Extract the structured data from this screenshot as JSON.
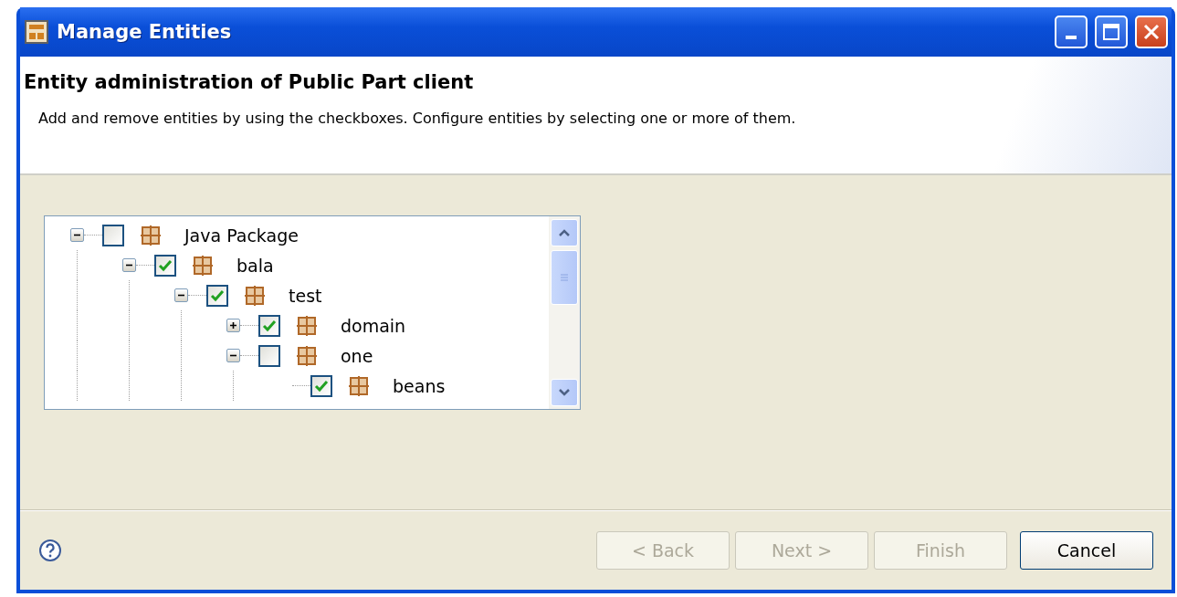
{
  "window": {
    "title": "Manage Entities"
  },
  "header": {
    "title": "Entity administration of Public Part client",
    "description": "Add and remove entities by using the checkboxes. Configure entities by selecting one or more of them."
  },
  "tree": [
    {
      "label": "Java Package",
      "checked": false,
      "expanded": true,
      "children": [
        {
          "label": "bala",
          "checked": true,
          "expanded": true,
          "children": [
            {
              "label": "test",
              "checked": true,
              "expanded": true,
              "children": [
                {
                  "label": "domain",
                  "checked": true,
                  "expanded": false
                },
                {
                  "label": "one",
                  "checked": false,
                  "expanded": true,
                  "children": [
                    {
                      "label": "beans",
                      "checked": true
                    }
                  ]
                }
              ]
            }
          ]
        }
      ]
    }
  ],
  "buttons": [
    {
      "label": "< Back",
      "disabled": true
    },
    {
      "label": "Next >",
      "disabled": true
    },
    {
      "label": "Finish",
      "disabled": true
    },
    {
      "label": "Cancel",
      "disabled": false
    }
  ]
}
